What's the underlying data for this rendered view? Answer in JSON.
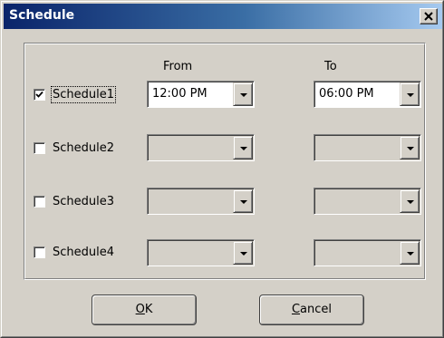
{
  "window": {
    "title": "Schedule"
  },
  "columns": {
    "from": "From",
    "to": "To"
  },
  "rows": [
    {
      "label": "Schedule1",
      "checked": true,
      "from": "12:00 PM",
      "to": "06:00 PM"
    },
    {
      "label": "Schedule2",
      "checked": false,
      "from": "",
      "to": ""
    },
    {
      "label": "Schedule3",
      "checked": false,
      "from": "",
      "to": ""
    },
    {
      "label": "Schedule4",
      "checked": false,
      "from": "",
      "to": ""
    }
  ],
  "buttons": {
    "ok": {
      "mnemonic": "O",
      "rest": "K"
    },
    "cancel": {
      "mnemonic": "C",
      "rest": "ancel"
    }
  },
  "colors": {
    "title_gradient_start": "#0a246a",
    "title_gradient_end": "#a6caf0",
    "dialog_background": "#d4d0c8"
  }
}
